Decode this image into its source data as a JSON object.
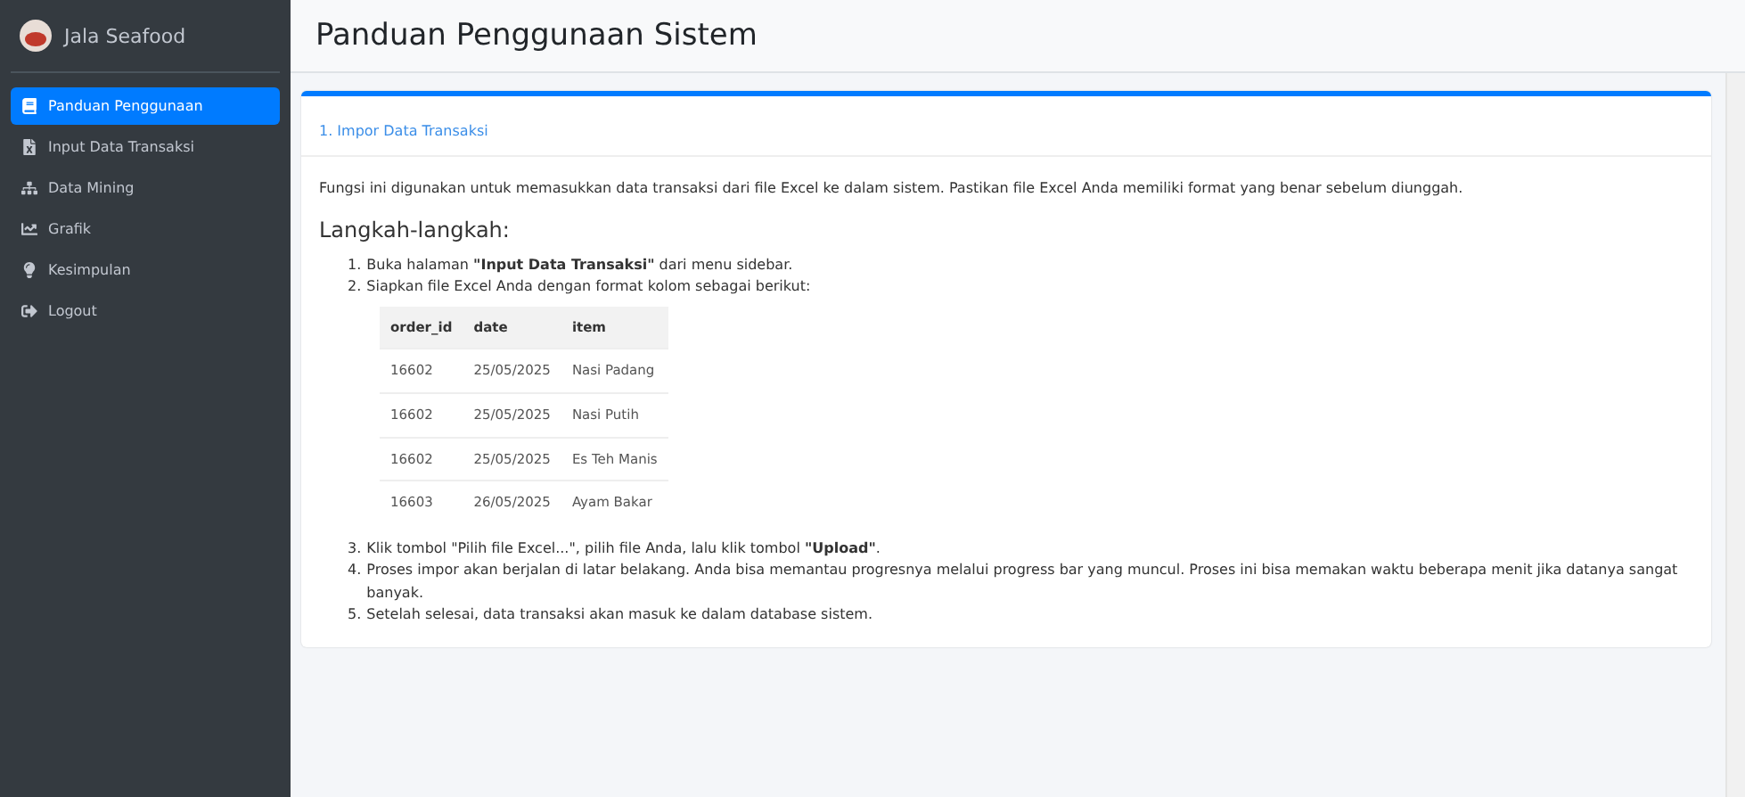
{
  "sidebar": {
    "brand": "Jala Seafood",
    "items": [
      {
        "label": "Panduan Penggunaan",
        "selected": true
      },
      {
        "label": "Input Data Transaksi",
        "selected": false
      },
      {
        "label": "Data Mining",
        "selected": false
      },
      {
        "label": "Grafik",
        "selected": false
      },
      {
        "label": "Kesimpulan",
        "selected": false
      },
      {
        "label": "Logout",
        "selected": false
      }
    ]
  },
  "page_title": "Panduan Penggunaan Sistem",
  "card": {
    "title": "1. Impor Data Transaksi",
    "intro": "Fungsi ini digunakan untuk memasukkan data transaksi dari file Excel ke dalam sistem. Pastikan file Excel Anda memiliki format yang benar sebelum diunggah.",
    "steps_heading": "Langkah-langkah:",
    "steps_before": [
      {
        "number": "1.",
        "text": "Buka halaman **\"Input Data Transaksi\"** dari menu sidebar."
      },
      {
        "number": "2.",
        "text": "Siapkan file Excel Anda dengan format kolom sebagai berikut:"
      }
    ],
    "table": {
      "columns": [
        "order_id",
        "date",
        "item"
      ],
      "rows": [
        [
          "16602",
          "25/05/2025",
          "Nasi Padang"
        ],
        [
          "16602",
          "25/05/2025",
          "Nasi Putih"
        ],
        [
          "16602",
          "25/05/2025",
          "Es Teh Manis"
        ],
        [
          "16603",
          "26/05/2025",
          "Ayam Bakar"
        ]
      ]
    },
    "steps_after": [
      {
        "number": "3.",
        "text": "Klik tombol \"Pilih file Excel...\", pilih file Anda, lalu klik tombol **\"Upload\"**."
      },
      {
        "number": "4.",
        "text": "Proses impor akan berjalan di latar belakang. Anda bisa memantau progresnya melalui progress bar yang muncul. Proses ini bisa memakan waktu beberapa menit jika datanya sangat banyak."
      },
      {
        "number": "5.",
        "text": "Setelah selesai, data transaksi akan masuk ke dalam database sistem."
      }
    ]
  }
}
